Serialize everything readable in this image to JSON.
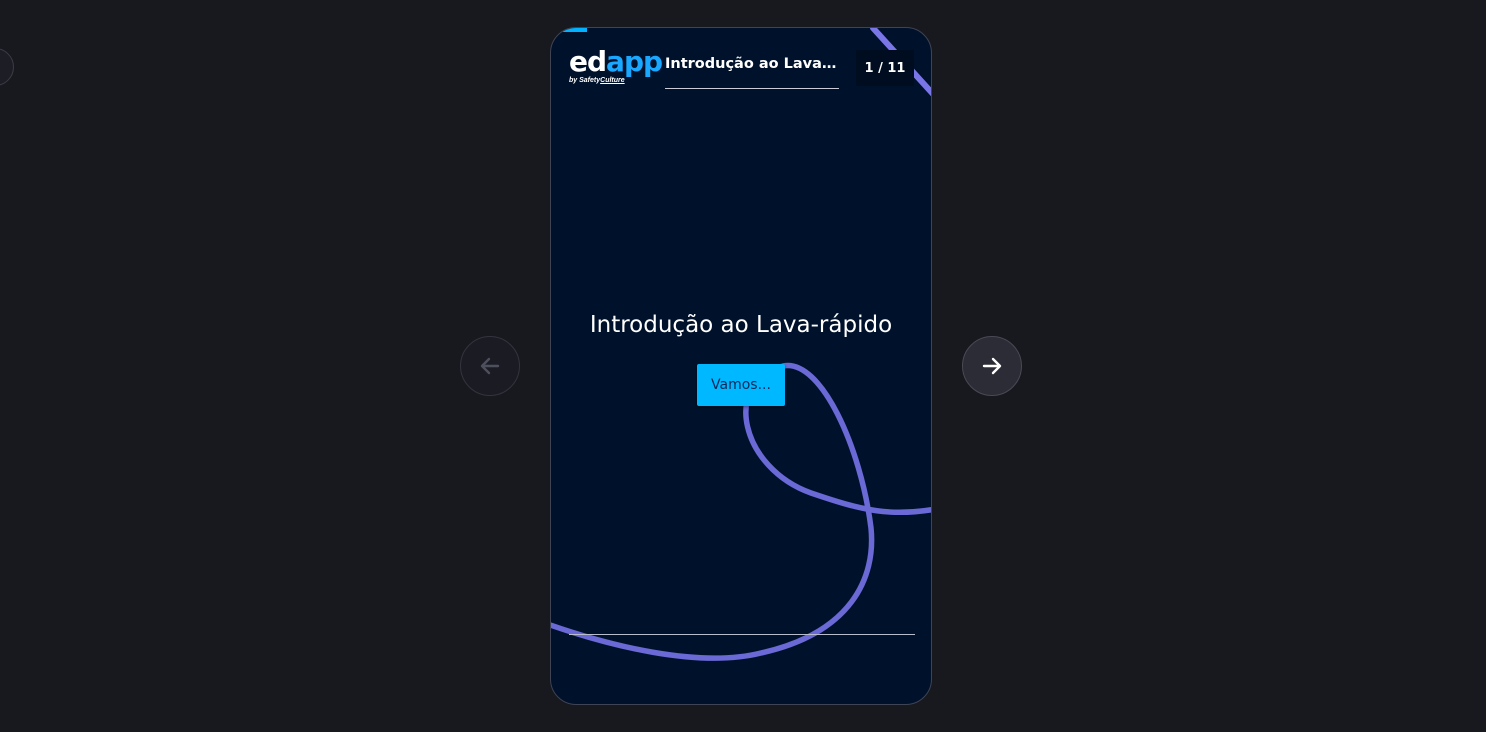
{
  "colors": {
    "page_background": "#18181f",
    "card_background": "#00122b",
    "accent": "#00b8ff",
    "decoration_line": "#6a69d6"
  },
  "logo": {
    "ed": "ed",
    "app": "app",
    "by": "by",
    "safety": "Safety",
    "culture": "Culture"
  },
  "header": {
    "lesson_title": "Introdução ao Lava-rá...",
    "page_counter": "1 / 11"
  },
  "slide": {
    "title": "Introdução ao Lava-rápido",
    "start_button": "Vamos..."
  },
  "nav": {
    "prev_icon": "arrow-left-icon",
    "next_icon": "arrow-right-icon"
  }
}
